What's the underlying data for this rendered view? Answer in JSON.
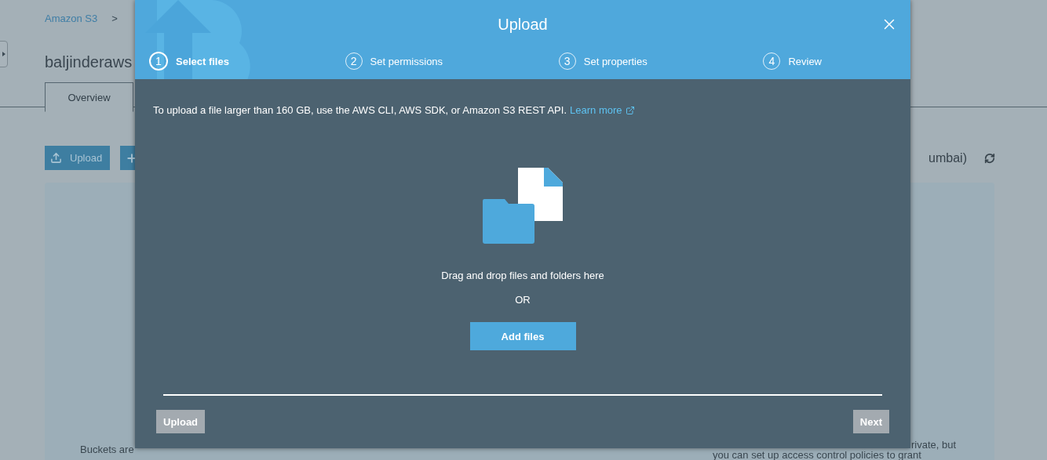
{
  "page": {
    "breadcrumb": {
      "root": "Amazon S3",
      "separator": ">"
    },
    "bucket_title": "baljinderaws",
    "tabs": [
      {
        "label": "Overview",
        "selected": true
      }
    ],
    "toolbar": {
      "upload_button": "Upload",
      "region": "umbai)"
    },
    "card": {
      "left_text": "Buckets are",
      "right_lines": [
        "rivate, but",
        "you can set up access control policies to grant"
      ]
    }
  },
  "dialog": {
    "title": "Upload",
    "steps": [
      {
        "number": "1",
        "label": "Select files",
        "selected": true
      },
      {
        "number": "2",
        "label": "Set permissions",
        "selected": false
      },
      {
        "number": "3",
        "label": "Set properties",
        "selected": false
      },
      {
        "number": "4",
        "label": "Review",
        "selected": false
      }
    ],
    "notice": "To upload a file larger than 160 GB, use the AWS CLI, AWS SDK, or Amazon S3 REST API.",
    "notice_link": "Learn more",
    "drop_text": "Drag and drop files and folders here",
    "or_text": "OR",
    "add_button": "Add files",
    "footer_buttons": [
      {
        "label": "Upload",
        "disabled": true
      },
      {
        "label": "Next",
        "disabled": true
      }
    ]
  }
}
